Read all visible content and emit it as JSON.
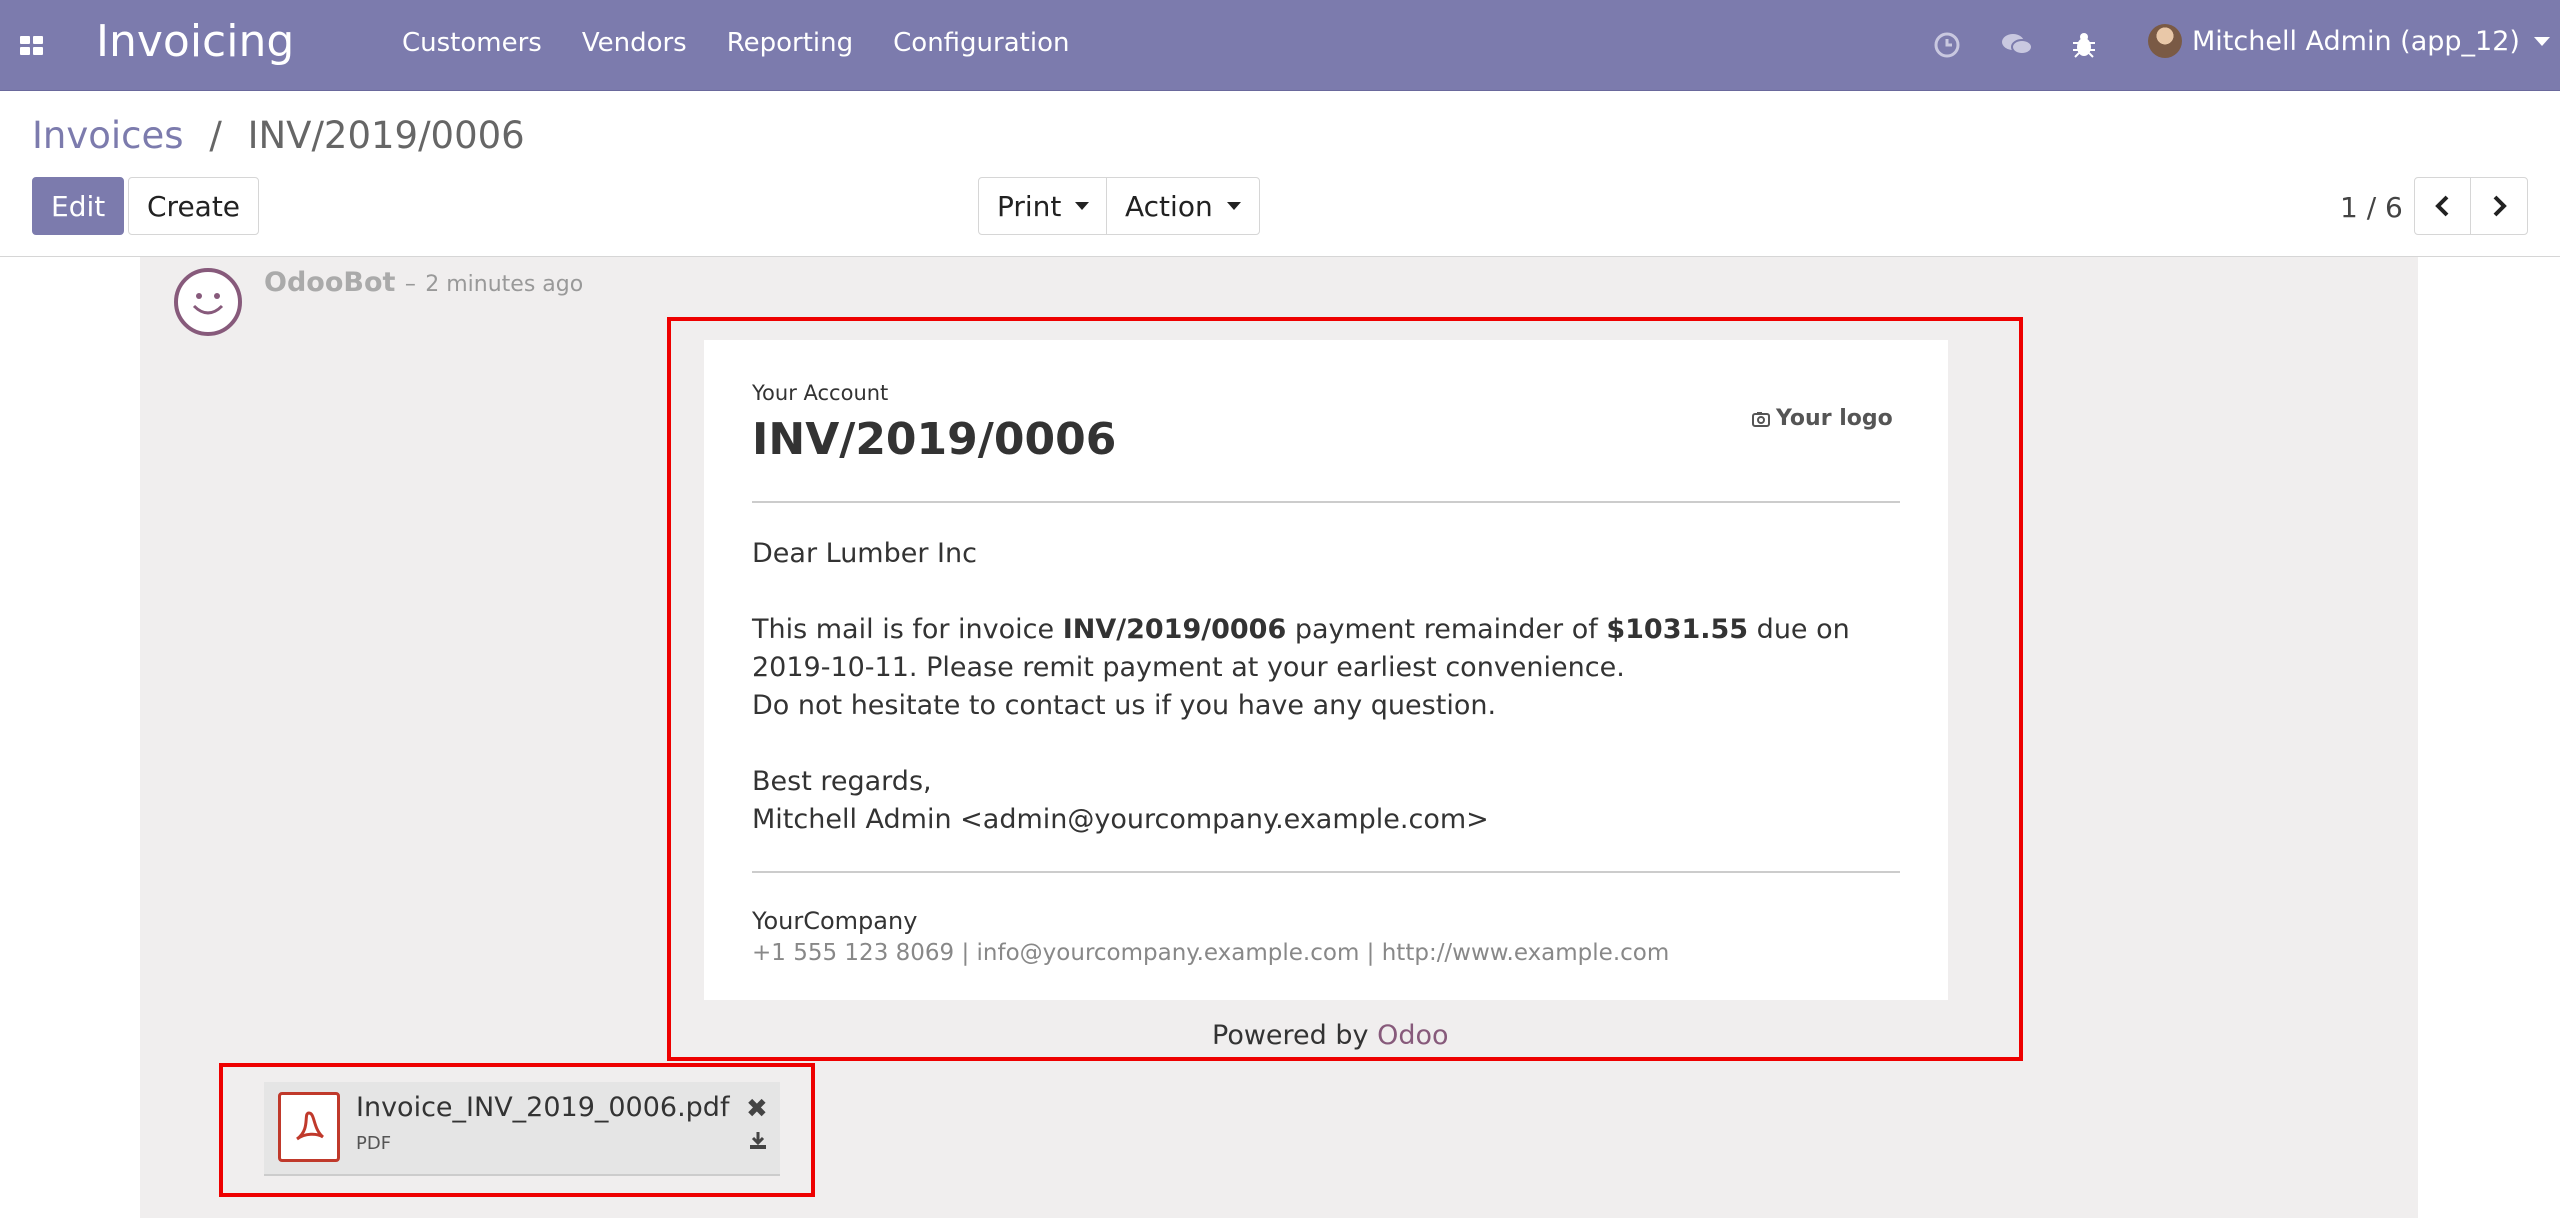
{
  "navbar": {
    "app_title": "Invoicing",
    "menu": [
      "Customers",
      "Vendors",
      "Reporting",
      "Configuration"
    ],
    "user": "Mitchell Admin (app_12)",
    "icons": [
      "clock-icon",
      "chat-icon",
      "bug-icon"
    ]
  },
  "breadcrumb": {
    "parent": "Invoices",
    "separator": "/",
    "current": "INV/2019/0006"
  },
  "buttons": {
    "edit": "Edit",
    "create": "Create",
    "print": "Print",
    "action": "Action"
  },
  "pager": {
    "value": "1 / 6"
  },
  "message": {
    "author": "OdooBot",
    "dash": "–",
    "date": "2 minutes ago",
    "account_label": "Your Account",
    "invoice": "INV/2019/0006",
    "logo": "Your logo",
    "greeting": "Dear Lumber Inc",
    "line1_a": "This mail is for invoice ",
    "line1_inv": "INV/2019/0006",
    "line1_b": " payment remainder of ",
    "amount": "$1031.55",
    "line1_c": " due on",
    "line2": "2019-10-11. Please remit payment at your earliest convenience.",
    "line3": "Do not hesitate to contact us if you have any question.",
    "regards": "Best regards,",
    "signature": "Mitchell Admin <admin@yourcompany.example.com>",
    "company": "YourCompany",
    "contact": "+1 555 123 8069 | info@yourcompany.example.com | http://www.example.com",
    "powered_by": "Powered by",
    "powered_brand": "Odoo"
  },
  "attachment": {
    "name": "Invoice_INV_2019_0006.pdf",
    "ext": "PDF"
  },
  "colors": {
    "brand": "#7c7bad",
    "odoo_purple": "#875a7b",
    "highlight": "#e00000"
  }
}
